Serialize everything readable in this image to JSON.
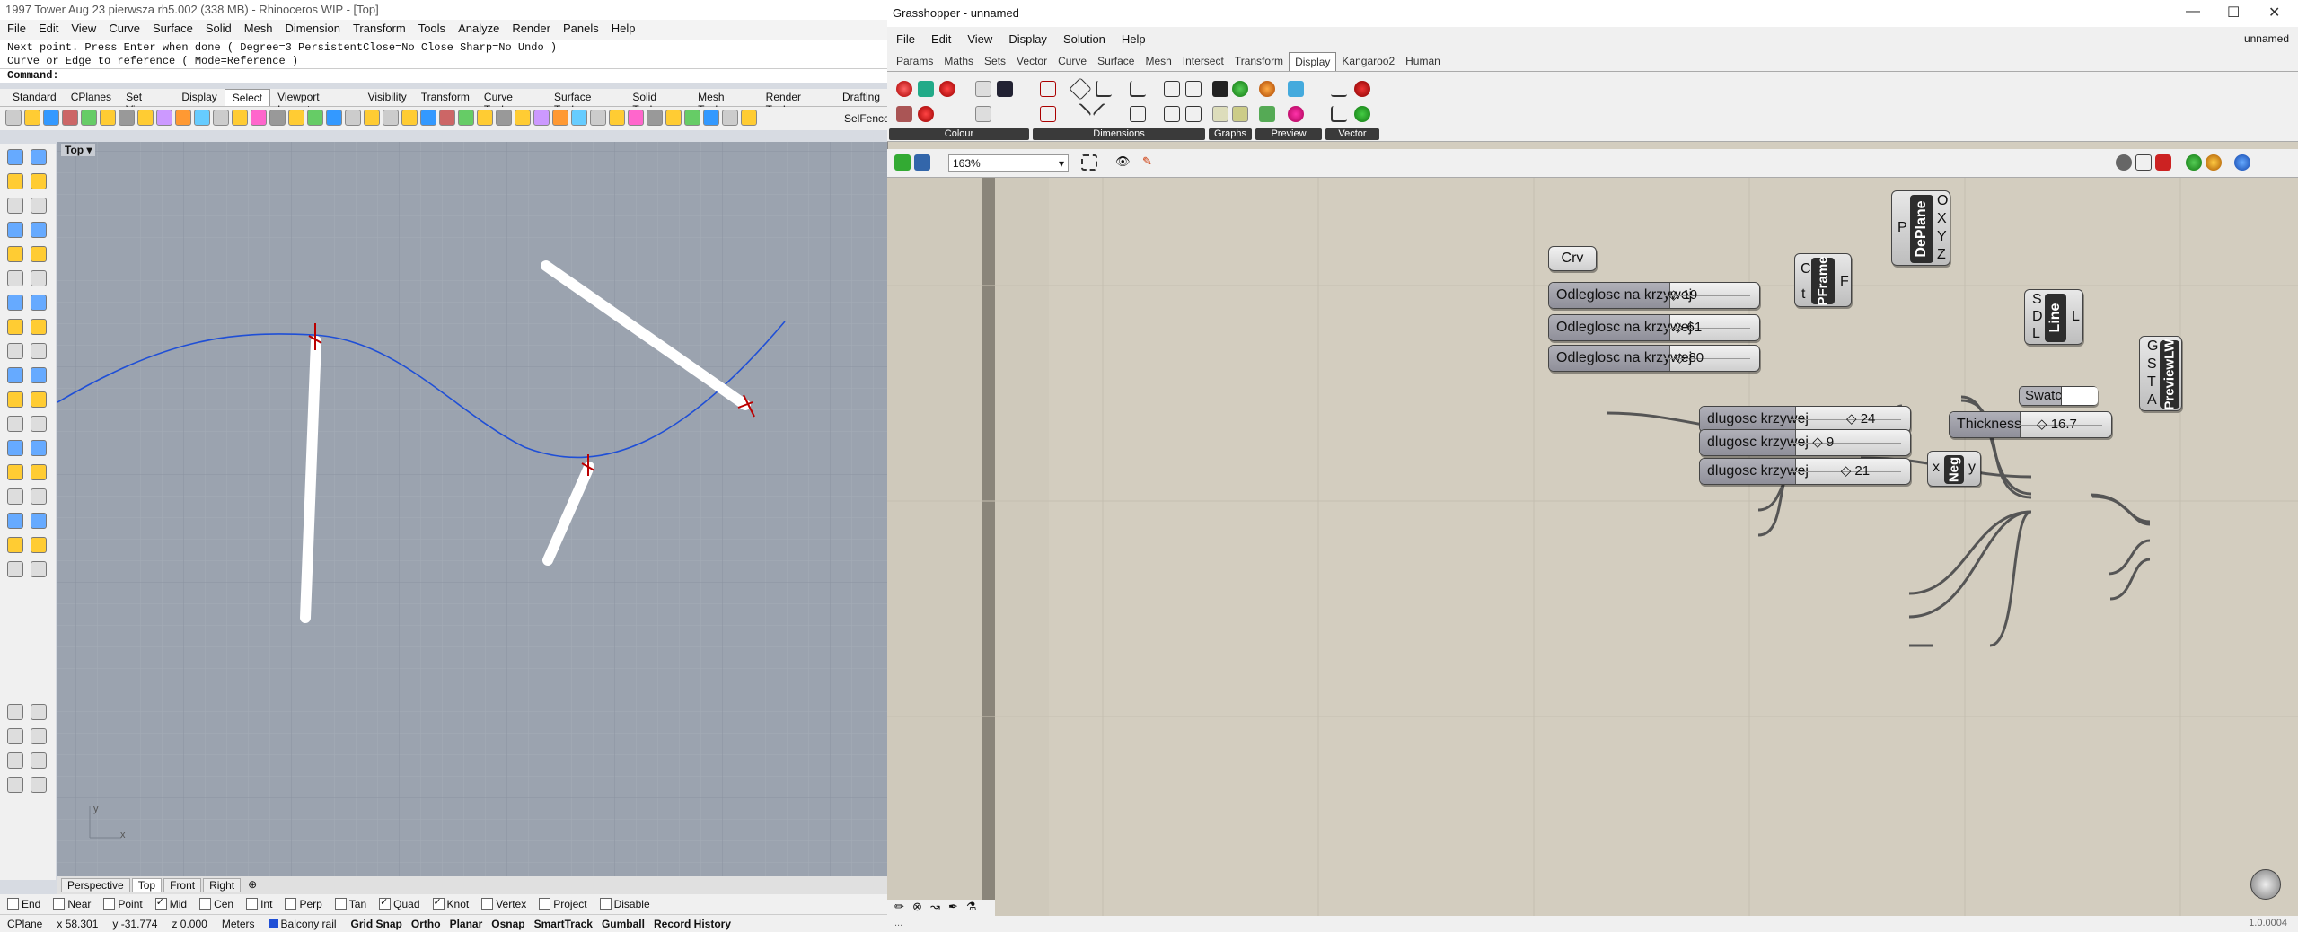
{
  "rhino": {
    "title": "1997 Tower Aug 23  pierwsza  rh5.002 (338 MB) - Rhinoceros WIP - [Top]",
    "menu": [
      "File",
      "Edit",
      "View",
      "Curve",
      "Surface",
      "Solid",
      "Mesh",
      "Dimension",
      "Transform",
      "Tools",
      "Analyze",
      "Render",
      "Panels",
      "Help"
    ],
    "history": [
      "Next point. Press Enter when done ( Degree=3  PersistentClose=No  Close  Sharp=No  Undo )",
      "Curve or Edge to reference ( Mode=Reference )"
    ],
    "command_label": "Command:",
    "toolbar_tabs": [
      "Standard",
      "CPlanes",
      "Set View",
      "Display",
      "Select",
      "Viewport Layout",
      "Visibility",
      "Transform",
      "Curve Tools",
      "Surface Tools",
      "Solid Tools",
      "Mesh Tools",
      "Render Tools",
      "Drafting"
    ],
    "active_toolbar_tab": "Select",
    "selfence_label": "SelFence",
    "viewport_label": "Top",
    "viewport_tabs": [
      "Perspective",
      "Top",
      "Front",
      "Right"
    ],
    "active_viewport_tab": "Top",
    "axis_x": "x",
    "axis_y": "y",
    "osnaps": [
      {
        "label": "End",
        "on": false
      },
      {
        "label": "Near",
        "on": false
      },
      {
        "label": "Point",
        "on": false
      },
      {
        "label": "Mid",
        "on": true
      },
      {
        "label": "Cen",
        "on": false
      },
      {
        "label": "Int",
        "on": false
      },
      {
        "label": "Perp",
        "on": false
      },
      {
        "label": "Tan",
        "on": false
      },
      {
        "label": "Quad",
        "on": true
      },
      {
        "label": "Knot",
        "on": true
      },
      {
        "label": "Vertex",
        "on": false
      },
      {
        "label": "Project",
        "on": false
      },
      {
        "label": "Disable",
        "on": false
      }
    ],
    "status": {
      "cplane": "CPlane",
      "x": "x 58.301",
      "y": "y -31.774",
      "z": "z 0.000",
      "units": "Meters",
      "layer": "Balcony rail",
      "layer_color": "#1f4fd6",
      "toggles": [
        "Grid Snap",
        "Ortho",
        "Planar",
        "Osnap",
        "SmartTrack",
        "Gumball",
        "Record History"
      ]
    }
  },
  "grasshopper": {
    "title": "Grasshopper - unnamed",
    "menu": [
      "File",
      "Edit",
      "View",
      "Display",
      "Solution",
      "Help"
    ],
    "doc_name": "unnamed",
    "tabs": [
      "Params",
      "Maths",
      "Sets",
      "Vector",
      "Curve",
      "Surface",
      "Mesh",
      "Intersect",
      "Transform",
      "Display",
      "Kangaroo2",
      "Human"
    ],
    "active_tab": "Display",
    "ribbon_groups": [
      "Colour",
      "Dimensions",
      "Graphs",
      "Preview",
      "Vector"
    ],
    "zoom": "163%",
    "version": "1.0.0004",
    "components": {
      "crv": "Crv",
      "pframe": "PFrame",
      "pframe_in": [
        "C",
        "t"
      ],
      "pframe_out": [
        "F"
      ],
      "deplane": "DePlane",
      "deplane_in": [
        "P"
      ],
      "deplane_out": [
        "O",
        "X",
        "Y",
        "Z"
      ],
      "line": "Line",
      "line_in": [
        "S",
        "D",
        "L"
      ],
      "line_out": [
        "L"
      ],
      "preview": "PreviewLW",
      "preview_in": [
        "G",
        "S",
        "T",
        "A"
      ],
      "neg": "Neg",
      "neg_in": [
        "x"
      ],
      "neg_out": [
        "y"
      ],
      "swatch": "Swatch",
      "swatch_color": "#ffffff"
    },
    "sliders": [
      {
        "label": "Odleglosc na krzywej",
        "value": "19",
        "fraction": 0.05
      },
      {
        "label": "Odleglosc na krzywej",
        "value": "61",
        "fraction": 0.1
      },
      {
        "label": "Odleglosc na krzywej",
        "value": "80",
        "fraction": 0.12
      },
      {
        "label": "dlugosc krzywej",
        "value": "24",
        "fraction": 0.5
      },
      {
        "label": "dlugosc krzywej",
        "value": "9",
        "fraction": 0.2
      },
      {
        "label": "dlugosc krzywej",
        "value": "21",
        "fraction": 0.45
      },
      {
        "label": "Thickness",
        "value": "16.7",
        "fraction": 0.25
      }
    ]
  }
}
